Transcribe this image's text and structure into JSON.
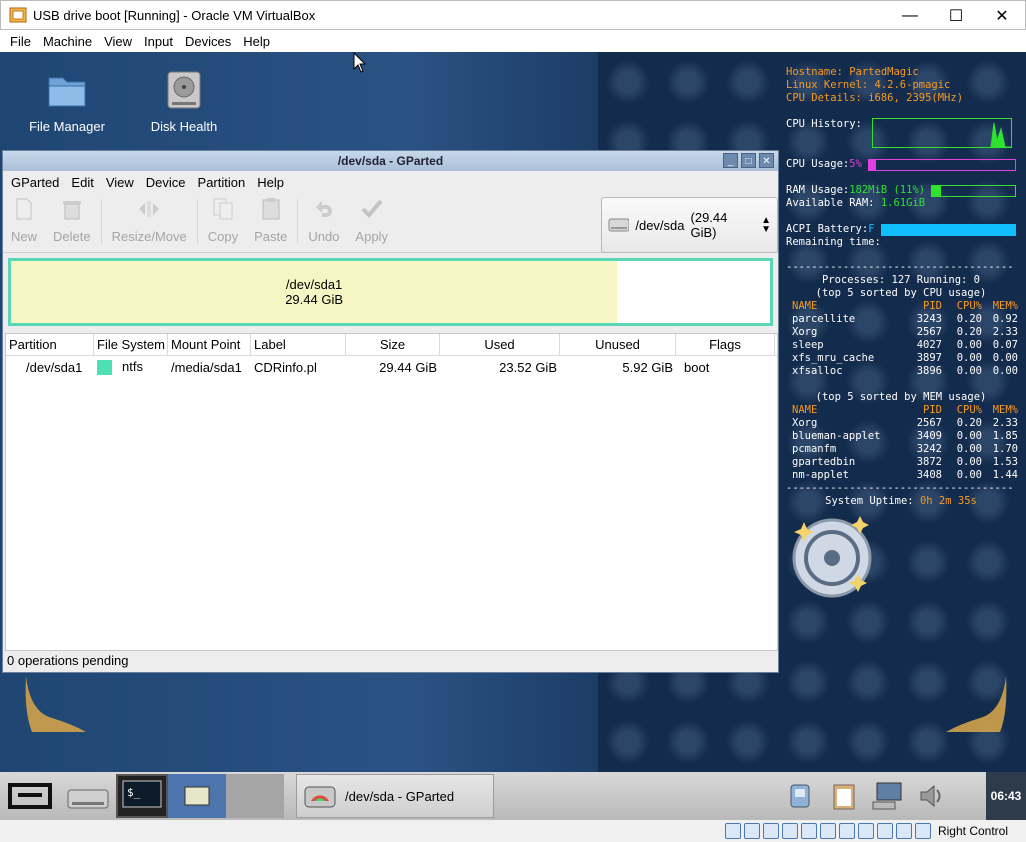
{
  "host": {
    "title": "USB drive boot [Running] - Oracle VM VirtualBox",
    "menu": [
      "File",
      "Machine",
      "View",
      "Input",
      "Devices",
      "Help"
    ],
    "host_key": "Right Control"
  },
  "desktop": {
    "icons": [
      {
        "label": "File Manager",
        "icon": "folder-icon"
      },
      {
        "label": "Disk Health",
        "icon": "hard-drive-icon"
      }
    ]
  },
  "conky": {
    "hostname_label": "Hostname: ",
    "hostname": "PartedMagic",
    "kernel_label": "Linux Kernel: ",
    "kernel": "4.2.6-pmagic",
    "cpu_details_label": "CPU Details: ",
    "cpu_details": "i686, 2395(MHz)",
    "cpu_history_label": "CPU History:",
    "cpu_usage_label": "CPU Usage: ",
    "cpu_usage": "5%",
    "cpu_usage_fraction": 0.05,
    "ram_usage_label": "RAM Usage: ",
    "ram_usage": "182MiB (11%)",
    "ram_usage_fraction": 0.11,
    "available_ram_label": "Available RAM: ",
    "available_ram": "1.61GiB",
    "battery_label": "ACPI Battery: ",
    "battery": "F",
    "battery_fraction": 1.0,
    "remaining_label": "Remaining time:",
    "processes_line": "Processes: 127  Running: 0",
    "cpu_sort_label": "(top 5 sorted by CPU usage)",
    "mem_sort_label": "(top 5 sorted by MEM usage)",
    "cols": [
      "NAME",
      "PID",
      "CPU%",
      "MEM%"
    ],
    "top_cpu": [
      [
        "parcellite",
        "3243",
        "0.20",
        "0.92"
      ],
      [
        "Xorg",
        "2567",
        "0.20",
        "2.33"
      ],
      [
        "sleep",
        "4027",
        "0.00",
        "0.07"
      ],
      [
        "xfs_mru_cache",
        "3897",
        "0.00",
        "0.00"
      ],
      [
        "xfsalloc",
        "3896",
        "0.00",
        "0.00"
      ]
    ],
    "top_mem": [
      [
        "Xorg",
        "2567",
        "0.20",
        "2.33"
      ],
      [
        "blueman-applet",
        "3409",
        "0.00",
        "1.85"
      ],
      [
        "pcmanfm",
        "3242",
        "0.00",
        "1.70"
      ],
      [
        "gpartedbin",
        "3872",
        "0.00",
        "1.53"
      ],
      [
        "nm-applet",
        "3408",
        "0.00",
        "1.44"
      ]
    ],
    "uptime_label": "System Uptime: ",
    "uptime": "0h 2m 35s"
  },
  "gparted": {
    "title": "/dev/sda - GParted",
    "menu": [
      "GParted",
      "Edit",
      "View",
      "Device",
      "Partition",
      "Help"
    ],
    "toolbar": [
      "New",
      "Delete",
      "Resize/Move",
      "Copy",
      "Paste",
      "Undo",
      "Apply"
    ],
    "device": "/dev/sda",
    "device_size": "(29.44 GiB)",
    "diskbar": {
      "name": "/dev/sda1",
      "size": "29.44 GiB",
      "used_fraction": 0.7987
    },
    "columns": [
      "Partition",
      "File System",
      "Mount Point",
      "Label",
      "Size",
      "Used",
      "Unused",
      "Flags"
    ],
    "rows": [
      {
        "partition": "/dev/sda1",
        "fs": "ntfs",
        "fs_color": "#4ee0b4",
        "mount": "/media/sda1",
        "label": "CDRinfo.pl",
        "size": "29.44 GiB",
        "used": "23.52 GiB",
        "unused": "5.92 GiB",
        "flags": "boot"
      }
    ],
    "status": "0 operations pending"
  },
  "taskbar": {
    "task_label": "/dev/sda - GParted",
    "clock": "06:43"
  }
}
